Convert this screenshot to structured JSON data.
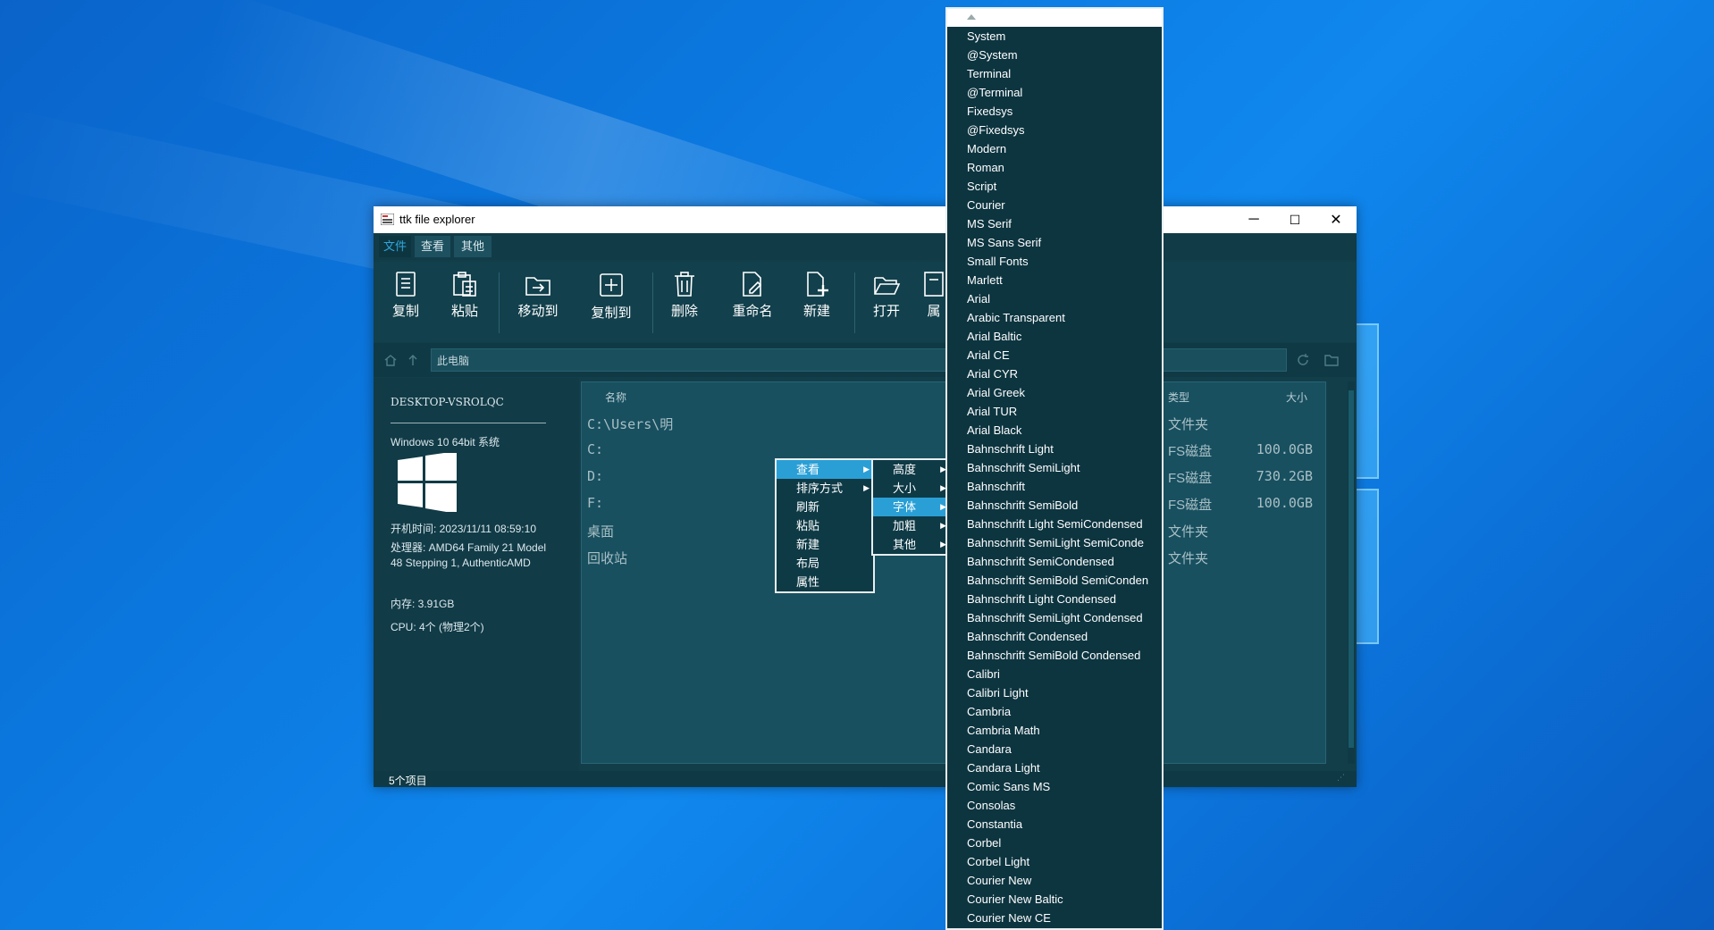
{
  "window": {
    "title": "ttk file explorer",
    "minimize": "─",
    "maximize": "☐",
    "close": "✕"
  },
  "menu": [
    "文件",
    "查看",
    "其他"
  ],
  "toolbar": [
    "复制",
    "粘贴",
    "移动到",
    "复制到",
    "删除",
    "重命名",
    "新建",
    "打开",
    "属"
  ],
  "address": {
    "path": "此电脑"
  },
  "sysinfo": {
    "host": "DESKTOP-VSROLQC",
    "os": "Windows 10 64bit 系统",
    "boot": "开机时间: 2023/11/11 08:59:10",
    "cpu_model": "处理器: AMD64 Family 21 Model 48 Stepping 1, AuthenticAMD",
    "memory": "内存: 3.91GB",
    "cores": "CPU: 4个 (物理2个)"
  },
  "columns": {
    "name": "名称",
    "type": "类型",
    "size": "大小"
  },
  "rows": [
    {
      "name": "C:\\Users\\明",
      "type": "文件夹",
      "size": ""
    },
    {
      "name": "C:",
      "type": "FS磁盘",
      "size": "100.0GB"
    },
    {
      "name": "D:",
      "type": "FS磁盘",
      "size": "730.2GB"
    },
    {
      "name": "F:",
      "type": "FS磁盘",
      "size": "100.0GB"
    },
    {
      "name": "桌面",
      "type": "文件夹",
      "size": ""
    },
    {
      "name": "回收站",
      "type": "文件夹",
      "size": ""
    }
  ],
  "status": "5个项目",
  "context_menu": [
    "查看",
    "排序方式",
    "刷新",
    "粘贴",
    "新建",
    "布局",
    "属性"
  ],
  "view_submenu": [
    "高度",
    "大小",
    "字体",
    "加粗",
    "其他"
  ],
  "fonts": [
    "System",
    "@System",
    "Terminal",
    "@Terminal",
    "Fixedsys",
    "@Fixedsys",
    "Modern",
    "Roman",
    "Script",
    "Courier",
    "MS Serif",
    "MS Sans Serif",
    "Small Fonts",
    "Marlett",
    "Arial",
    "Arabic Transparent",
    "Arial Baltic",
    "Arial CE",
    "Arial CYR",
    "Arial Greek",
    "Arial TUR",
    "Arial Black",
    "Bahnschrift Light",
    "Bahnschrift SemiLight",
    "Bahnschrift",
    "Bahnschrift SemiBold",
    "Bahnschrift Light SemiCondensed",
    "Bahnschrift SemiLight SemiConde",
    "Bahnschrift SemiCondensed",
    "Bahnschrift SemiBold SemiConden",
    "Bahnschrift Light Condensed",
    "Bahnschrift SemiLight Condensed",
    "Bahnschrift Condensed",
    "Bahnschrift SemiBold Condensed",
    "Calibri",
    "Calibri Light",
    "Cambria",
    "Cambria Math",
    "Candara",
    "Candara Light",
    "Comic Sans MS",
    "Consolas",
    "Constantia",
    "Corbel",
    "Corbel Light",
    "Courier New",
    "Courier New Baltic",
    "Courier New CE"
  ]
}
